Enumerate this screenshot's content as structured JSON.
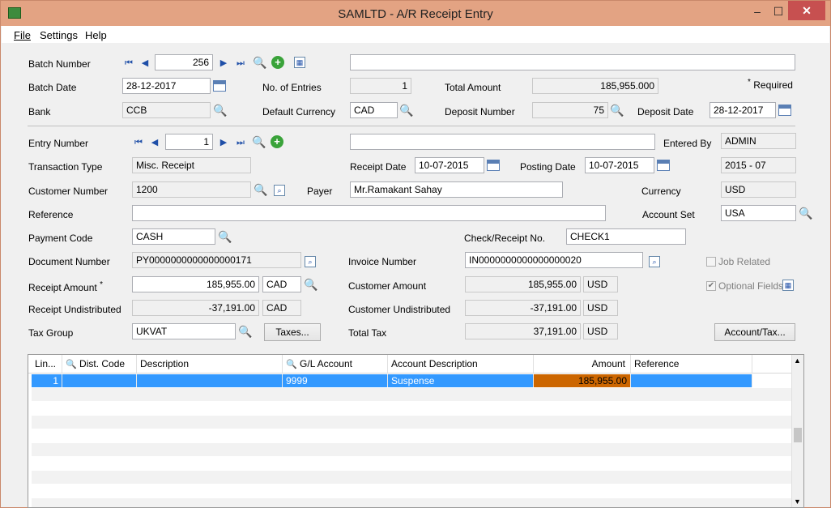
{
  "window": {
    "title": "SAMLTD - A/R Receipt Entry",
    "minimize": "–",
    "maximize": "☐",
    "close": "✕"
  },
  "menu": {
    "file": "File",
    "settings": "Settings",
    "help": "Help"
  },
  "batch": {
    "number_label": "Batch Number",
    "number": "256",
    "description": "",
    "date_label": "Batch Date",
    "date": "28-12-2017",
    "entries_label": "No. of Entries",
    "entries": "1",
    "total_label": "Total Amount",
    "total": "185,955.000",
    "required_label": "Required",
    "bank_label": "Bank",
    "bank": "CCB",
    "currency_label": "Default Currency",
    "currency": "CAD",
    "deposit_label": "Deposit Number",
    "deposit": "75",
    "deposit_date_label": "Deposit Date",
    "deposit_date": "28-12-2017"
  },
  "entry": {
    "number_label": "Entry Number",
    "number": "1",
    "description": "",
    "entered_by_label": "Entered By",
    "entered_by": "ADMIN",
    "type_label": "Transaction Type",
    "type": "Misc. Receipt",
    "receipt_date_label": "Receipt Date",
    "receipt_date": "10-07-2015",
    "posting_date_label": "Posting Date",
    "posting_date": "10-07-2015",
    "period": "2015 - 07",
    "customer_label": "Customer Number",
    "customer": "1200",
    "payer_label": "Payer",
    "payer": "Mr.Ramakant Sahay",
    "currency_label": "Currency",
    "currency": "USD",
    "reference_label": "Reference",
    "reference": "",
    "account_set_label": "Account Set",
    "account_set": "USA",
    "payment_code_label": "Payment Code",
    "payment_code": "CASH",
    "check_label": "Check/Receipt No.",
    "check": "CHECK1",
    "document_label": "Document Number",
    "document": "PY0000000000000000171",
    "invoice_label": "Invoice Number",
    "invoice": "IN0000000000000000020",
    "job_related_label": "Job Related",
    "receipt_amount_label": "Receipt Amount",
    "receipt_amount": "185,955.00",
    "receipt_currency": "CAD",
    "customer_amount_label": "Customer Amount",
    "customer_amount": "185,955.00",
    "customer_amount_currency": "USD",
    "optional_fields_label": "Optional Fields",
    "receipt_undistributed_label": "Receipt Undistributed",
    "receipt_undistributed": "-37,191.00",
    "receipt_undistributed_currency": "CAD",
    "customer_undistributed_label": "Customer Undistributed",
    "customer_undistributed": "-37,191.00",
    "customer_undistributed_currency": "USD",
    "tax_group_label": "Tax Group",
    "tax_group": "UKVAT",
    "taxes_button": "Taxes...",
    "total_tax_label": "Total Tax",
    "total_tax": "37,191.00",
    "total_tax_currency": "USD",
    "account_tax_button": "Account/Tax..."
  },
  "grid": {
    "headers": [
      "Lin...",
      "Dist. Code",
      "Description",
      "G/L Account",
      "Account Description",
      "Amount",
      "Reference"
    ],
    "rows": [
      {
        "line": "1",
        "dist_code": "",
        "description": "",
        "gl_account": "9999",
        "account_description": "Suspense",
        "amount": "185,955.00",
        "reference": ""
      }
    ]
  },
  "colors": {
    "titlebar": "#e3a383",
    "selected_row": "#3399ff",
    "amount_highlight": "#cc6600"
  }
}
